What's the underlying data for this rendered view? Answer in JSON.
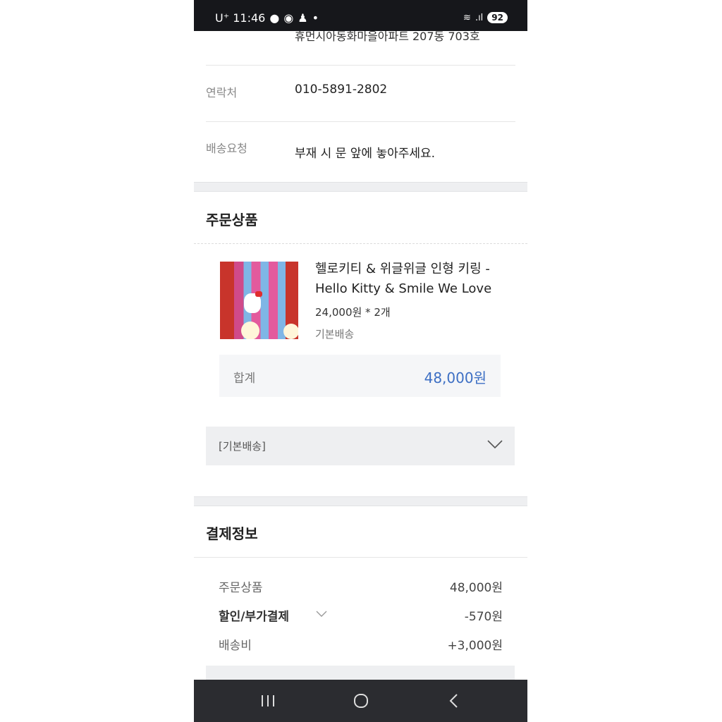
{
  "status_bar": {
    "carrier_time": "U⁺ 11:46",
    "battery": "92"
  },
  "delivery": {
    "address_partial": "휴먼시아동화마을아파트 207동 703호",
    "contact_label": "연락처",
    "contact_value": "010-5891-2802",
    "request_label": "배송요청",
    "request_value": "부재 시 문 앞에 놓아주세요."
  },
  "order_items": {
    "title": "주문상품",
    "product": {
      "name": "헬로키티 & 위글위글 인형 키링 - Hello Kitty & Smile We Love",
      "price_qty": "24,000원 * 2개",
      "shipping": "기본배송"
    },
    "total_label": "합계",
    "total_value": "48,000원",
    "shipping_select": "[기본배송]"
  },
  "payment": {
    "title": "결제정보",
    "rows": [
      {
        "label": "주문상품",
        "value": "48,000원"
      },
      {
        "label": "할인/부가결제",
        "value": "-570원"
      },
      {
        "label": "배송비",
        "value": "+3,000원"
      }
    ]
  },
  "nav": {
    "recent": "|||",
    "home": "○",
    "back": "<"
  }
}
